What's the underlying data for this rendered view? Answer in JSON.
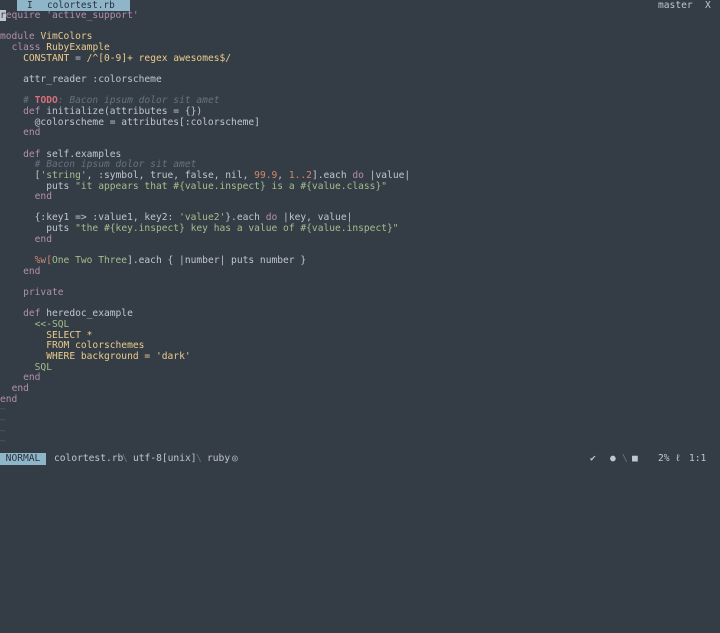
{
  "tab": {
    "flag": "I",
    "filename": "colortest.rb"
  },
  "branch": "master",
  "close": "X",
  "status": {
    "mode": "NORMAL",
    "file": "colortest.rb",
    "encoding": "utf-8[unix]",
    "filetype": "ruby",
    "filetype_icon": "◎",
    "check": "✔",
    "dot": "●",
    "square": "■",
    "percent": "2%",
    "ln_icon": "ℓ",
    "position": "1:1"
  },
  "code": {
    "l1": "equire 'active_support'",
    "l1_cursor": "r",
    "module_kw": "module",
    "module_name": "VimColors",
    "class_kw": "class",
    "class_name": "RubyExample",
    "const_name": "CONSTANT",
    "const_eq": "=",
    "regex": "/^[0-9]+ regex awesomes$/",
    "attr": "attr_reader :colorscheme",
    "todo_hash": "# ",
    "todo": "TODO",
    "todo_rest": ": Bacon ipsum dolor sit amet",
    "def_kw": "def",
    "init_sig": "initialize(attributes = {})",
    "ivar_assign": "@colorscheme = attributes[:colorscheme]",
    "end_kw": "end",
    "self_examples": "self.examples",
    "bacon_comment": "# Bacon ipsum dolor sit amet",
    "arr_open": "[",
    "arr_str": "'string'",
    "arr_mid": ", :symbol, true, false, nil, ",
    "arr_num1": "99.9",
    "arr_sep": ", ",
    "arr_num2": "1..2",
    "arr_close": "].each ",
    "do_kw": "do",
    "arr_block": " |value|",
    "puts_kw": "puts",
    "puts1": "\"it appears that #{value.inspect} is a #{value.class}\"",
    "hash_open": "{:key1 => :value1, key2: ",
    "hash_val2": "'value2'",
    "hash_close": "}.each ",
    "hash_block": " |key, value|",
    "puts2": "\"the #{key.inspect} key has a value of #{value.inspect}\"",
    "pw_open": "%w[",
    "pw_words": "One Two Three",
    "pw_close": "].each { |number| puts number }",
    "private_kw": "private",
    "heredoc_name": "heredoc_example",
    "heredoc_open": "<<-SQL",
    "sql1": "SELECT *",
    "sql2": "FROM colorschemes",
    "sql3": "WHERE background = 'dark'",
    "heredoc_close": "SQL",
    "tilde": "~"
  }
}
